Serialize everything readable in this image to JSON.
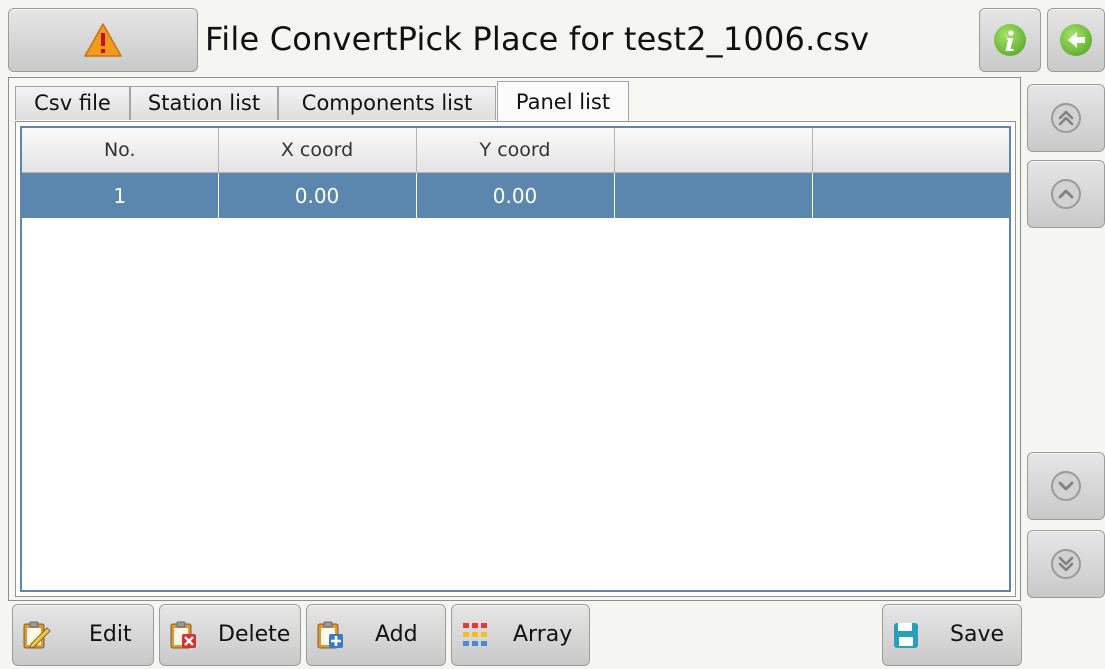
{
  "header": {
    "title": "File ConvertPick Place for test2_1006.csv",
    "warning_icon": "warning-triangle-icon",
    "info_icon": "info-icon",
    "back_icon": "back-arrow-icon"
  },
  "tabs": [
    {
      "label": "Csv file",
      "active": false
    },
    {
      "label": "Station list",
      "active": false
    },
    {
      "label": "Components list",
      "active": false
    },
    {
      "label": "Panel list",
      "active": true
    }
  ],
  "table": {
    "columns": [
      "No.",
      "X coord",
      "Y coord",
      "",
      ""
    ],
    "rows": [
      [
        "1",
        "0.00",
        "0.00",
        "",
        ""
      ]
    ],
    "selected_row_color": "#5b86ae"
  },
  "side_nav": {
    "page_up_icon": "double-chevron-up-icon",
    "up_icon": "chevron-up-icon",
    "down_icon": "chevron-down-icon",
    "page_down_icon": "double-chevron-down-icon"
  },
  "toolbar": {
    "edit_label": "Edit",
    "delete_label": "Delete",
    "add_label": "Add",
    "array_label": "Array",
    "save_label": "Save"
  },
  "colors": {
    "accent_blue": "#5b86ae",
    "info_green": "#5fb62e",
    "warning_orange": "#f39a1e"
  }
}
